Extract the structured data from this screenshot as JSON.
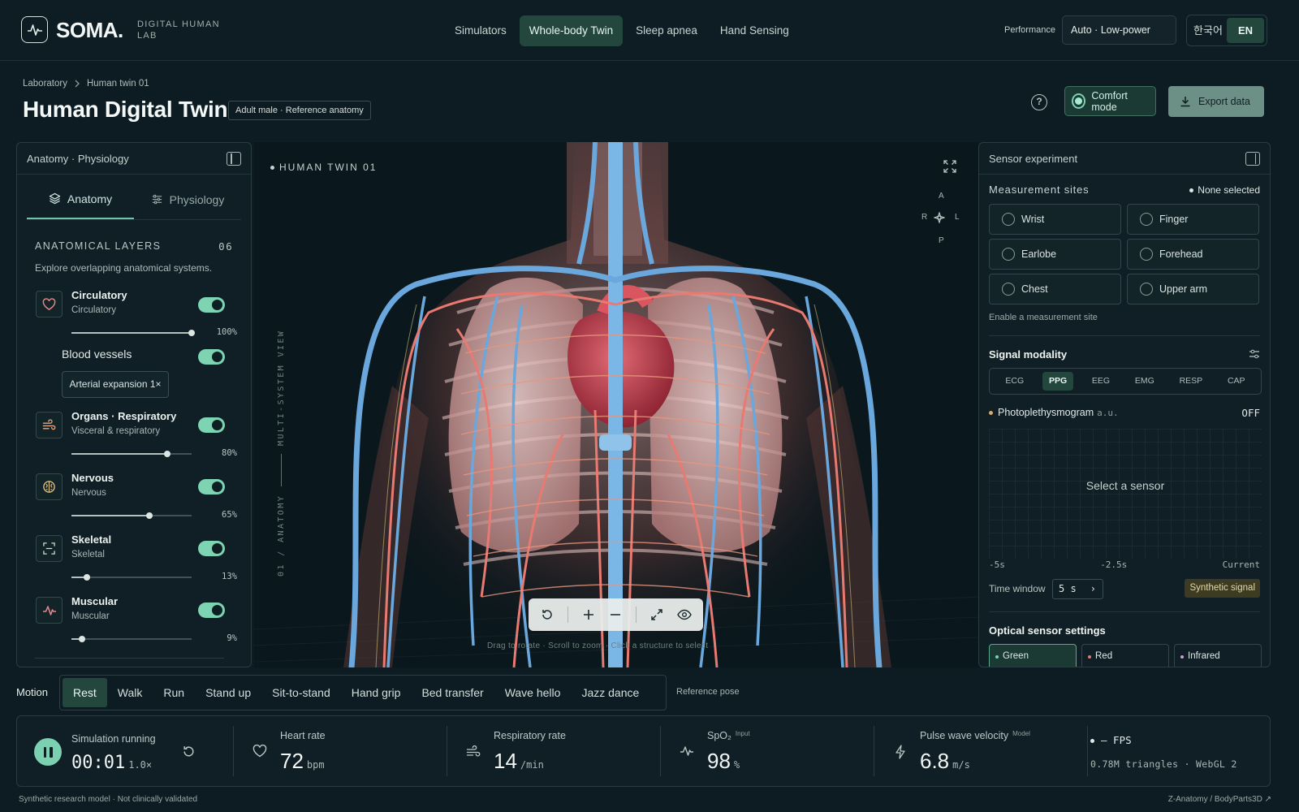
{
  "app": {
    "brand": "SOMA.",
    "brand_sub": "DIGITAL HUMAN LAB",
    "nav": [
      {
        "label": "Simulators",
        "active": false
      },
      {
        "label": "Whole-body Twin",
        "active": true
      },
      {
        "label": "Sleep apnea",
        "active": false
      },
      {
        "label": "Hand Sensing",
        "active": false
      }
    ],
    "performance_label": "Performance",
    "performance_value": "Auto · Low-power",
    "lang_ko": "한국어",
    "lang_en": "EN"
  },
  "header": {
    "breadcrumb": [
      "Laboratory",
      "Human twin 01"
    ],
    "title": "Human Digital Twin",
    "badge": "Adult male · Reference anatomy",
    "help": "?",
    "comfort_label": "Comfort mode",
    "export_label": "Export data"
  },
  "left_panel": {
    "title": "Anatomy · Physiology",
    "tab_anatomy": "Anatomy",
    "tab_physiology": "Physiology",
    "layers_title": "ANATOMICAL LAYERS",
    "layers_count": "06",
    "layers_desc": "Explore overlapping anatomical systems.",
    "layers": [
      {
        "name": "Circulatory",
        "sub": "Circulatory",
        "value": 100,
        "pct": "100%",
        "icon": "heart-icon"
      },
      {
        "name": "Organs · Respiratory",
        "sub": "Visceral & respiratory",
        "value": 80,
        "pct": "80%",
        "icon": "wind-icon"
      },
      {
        "name": "Nervous",
        "sub": "Nervous",
        "value": 65,
        "pct": "65%",
        "icon": "brain-icon"
      },
      {
        "name": "Skeletal",
        "sub": "Skeletal",
        "value": 13,
        "pct": "13%",
        "icon": "scan-icon"
      },
      {
        "name": "Muscular",
        "sub": "Muscular",
        "value": 9,
        "pct": "9%",
        "icon": "pulse-icon"
      }
    ],
    "blood_vessels": "Blood vessels",
    "arterial": "Arterial expansion 1×"
  },
  "viewport": {
    "label": "HUMAN TWIN 01",
    "vertical_label": "01 / ANATOMY",
    "vertical_label_2": "MULTI-SYSTEM VIEW",
    "compass": {
      "a": "A",
      "r": "R",
      "l": "L",
      "p": "P"
    },
    "hint": "Drag to rotate · Scroll to zoom · Click a structure to select"
  },
  "right_panel": {
    "title": "Sensor experiment",
    "sites_title": "Measurement sites",
    "sites_status": "None selected",
    "sites": [
      "Wrist",
      "Finger",
      "Earlobe",
      "Forehead",
      "Chest",
      "Upper arm"
    ],
    "enable_hint": "Enable a measurement site",
    "modality_title": "Signal modality",
    "modalities": [
      {
        "label": "ECG",
        "active": false
      },
      {
        "label": "PPG",
        "active": true
      },
      {
        "label": "EEG",
        "active": false
      },
      {
        "label": "EMG",
        "active": false
      },
      {
        "label": "RESP",
        "active": false
      },
      {
        "label": "CAP",
        "active": false
      }
    ],
    "signal_name": "Photoplethysmogram",
    "signal_unit": "a.u.",
    "signal_state": "OFF",
    "graph_msg": "Select a sensor",
    "axis": [
      "-5s",
      "-2.5s",
      "Current"
    ],
    "time_window_label": "Time window",
    "time_window_value": "5 s",
    "synthetic": "Synthetic signal",
    "optical_title": "Optical sensor settings",
    "optical": [
      {
        "label": "Green",
        "active": true,
        "color": "#7fd0b3"
      },
      {
        "label": "Red",
        "active": false,
        "color": "#e07a7a"
      },
      {
        "label": "Infrared",
        "active": false,
        "color": "#c9a0d8"
      }
    ]
  },
  "motion": {
    "label": "Motion",
    "items": [
      {
        "label": "Rest",
        "active": true
      },
      {
        "label": "Walk",
        "active": false
      },
      {
        "label": "Run",
        "active": false
      },
      {
        "label": "Stand up",
        "active": false
      },
      {
        "label": "Sit-to-stand",
        "active": false
      },
      {
        "label": "Hand grip",
        "active": false
      },
      {
        "label": "Bed transfer",
        "active": false
      },
      {
        "label": "Wave hello",
        "active": false
      },
      {
        "label": "Jazz dance",
        "active": false
      }
    ],
    "ref_pose": "Reference pose"
  },
  "stats": {
    "sim_label": "Simulation running",
    "sim_time": "00:01",
    "sim_speed": "1.0×",
    "hr_label": "Heart rate",
    "hr_value": "72",
    "hr_unit": "bpm",
    "rr_label": "Respiratory rate",
    "rr_value": "14",
    "rr_unit": "/min",
    "spo2_label": "SpO₂",
    "spo2_tag": "Input",
    "spo2_value": "98",
    "spo2_unit": "%",
    "pwv_label": "Pulse wave velocity",
    "pwv_tag": "Model",
    "pwv_value": "6.8",
    "pwv_unit": "m/s",
    "fps": "— FPS",
    "triangles": "0.78M triangles · WebGL 2"
  },
  "footer": {
    "left": "Synthetic research model · Not clinically validated",
    "right": "Z-Anatomy / BodyParts3D ↗"
  }
}
